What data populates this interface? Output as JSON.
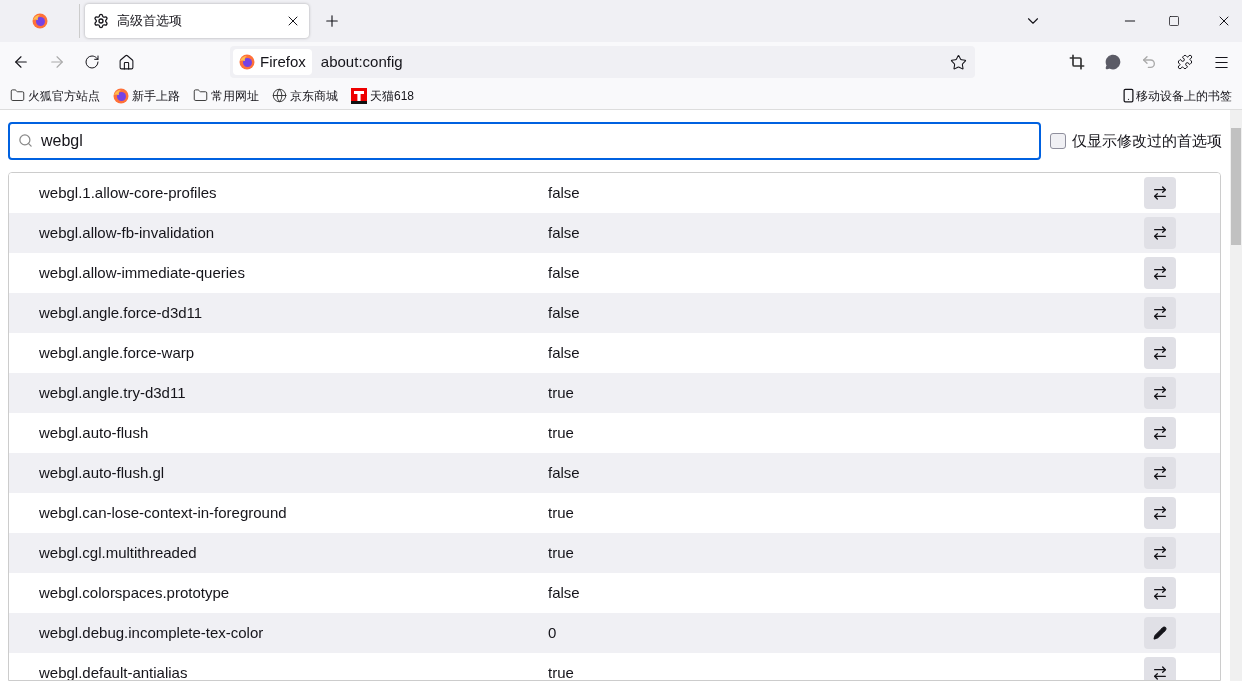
{
  "tabs": [
    {
      "kind": "pinned",
      "selected": false
    },
    {
      "kind": "normal",
      "label": "高级首选项",
      "selected": true
    }
  ],
  "address": {
    "identity": "Firefox",
    "url": "about:config"
  },
  "bookmarks": [
    {
      "kind": "folder",
      "label": "火狐官方站点"
    },
    {
      "kind": "firefox",
      "label": "新手上路"
    },
    {
      "kind": "folder",
      "label": "常用网址"
    },
    {
      "kind": "globe",
      "label": "京东商城"
    },
    {
      "kind": "tmall",
      "label": "天猫618"
    }
  ],
  "mobile_bookmarks": "移动设备上的书签",
  "search": {
    "value": "webgl"
  },
  "modified_only": {
    "label": "仅显示修改过的首选项",
    "checked": false
  },
  "prefs": [
    {
      "name": "webgl.1.allow-core-profiles",
      "value": "false",
      "kind": "toggle"
    },
    {
      "name": "webgl.allow-fb-invalidation",
      "value": "false",
      "kind": "toggle"
    },
    {
      "name": "webgl.allow-immediate-queries",
      "value": "false",
      "kind": "toggle"
    },
    {
      "name": "webgl.angle.force-d3d11",
      "value": "false",
      "kind": "toggle"
    },
    {
      "name": "webgl.angle.force-warp",
      "value": "false",
      "kind": "toggle"
    },
    {
      "name": "webgl.angle.try-d3d11",
      "value": "true",
      "kind": "toggle"
    },
    {
      "name": "webgl.auto-flush",
      "value": "true",
      "kind": "toggle"
    },
    {
      "name": "webgl.auto-flush.gl",
      "value": "false",
      "kind": "toggle"
    },
    {
      "name": "webgl.can-lose-context-in-foreground",
      "value": "true",
      "kind": "toggle"
    },
    {
      "name": "webgl.cgl.multithreaded",
      "value": "true",
      "kind": "toggle"
    },
    {
      "name": "webgl.colorspaces.prototype",
      "value": "false",
      "kind": "toggle"
    },
    {
      "name": "webgl.debug.incomplete-tex-color",
      "value": "0",
      "kind": "edit"
    },
    {
      "name": "webgl.default-antialias",
      "value": "true",
      "kind": "toggle"
    }
  ]
}
